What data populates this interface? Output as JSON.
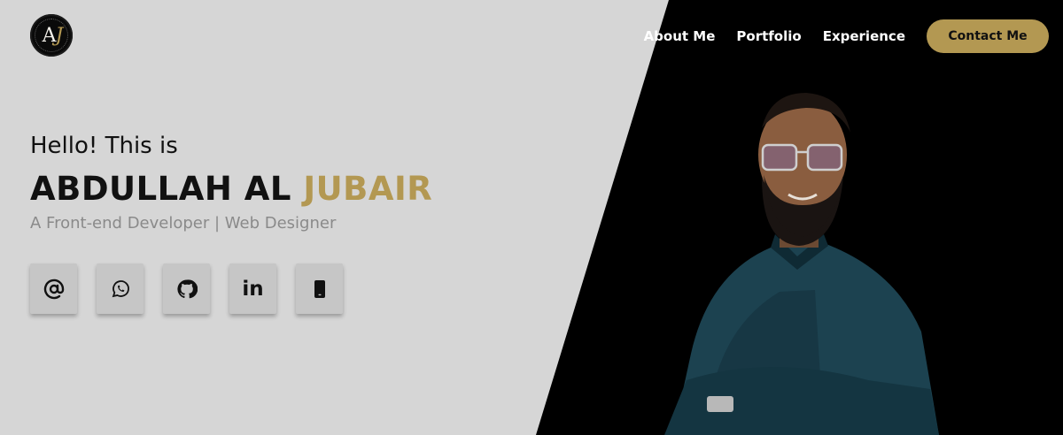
{
  "brand": {
    "logo_initial_1": "A",
    "logo_initial_2": "J"
  },
  "nav": {
    "items": [
      "About Me",
      "Portfolio",
      "Experience"
    ],
    "contact_label": "Contact Me"
  },
  "hero": {
    "greeting": "Hello! This is",
    "name_first": "ABDULLAH AL ",
    "name_last": "JUBAIR",
    "tagline": "A Front-end Developer | Web Designer"
  },
  "social": {
    "linkedin_text": "in",
    "icons": [
      "at-icon",
      "whatsapp-icon",
      "github-icon",
      "linkedin-icon",
      "phone-icon"
    ]
  },
  "colors": {
    "accent": "#b39852",
    "dark_panel": "#000000",
    "light_panel": "#d6d6d6",
    "muted_text": "#8a8a8a"
  }
}
